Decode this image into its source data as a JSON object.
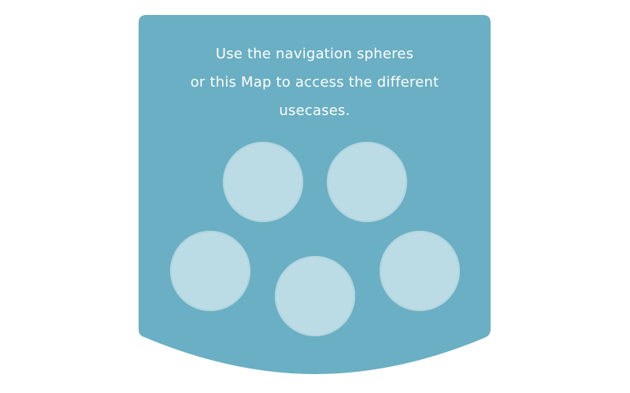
{
  "map": {
    "instructions": {
      "line1": "Use the navigation spheres",
      "line2": "or this Map to access the different",
      "line3": "usecases."
    },
    "spheres": [
      {
        "name": "sphere-1"
      },
      {
        "name": "sphere-2"
      },
      {
        "name": "sphere-3"
      },
      {
        "name": "sphere-4"
      },
      {
        "name": "sphere-5"
      }
    ]
  },
  "colors": {
    "panel": "#6aafc3",
    "sphere": "#bcdce5",
    "text": "#ffffff"
  }
}
